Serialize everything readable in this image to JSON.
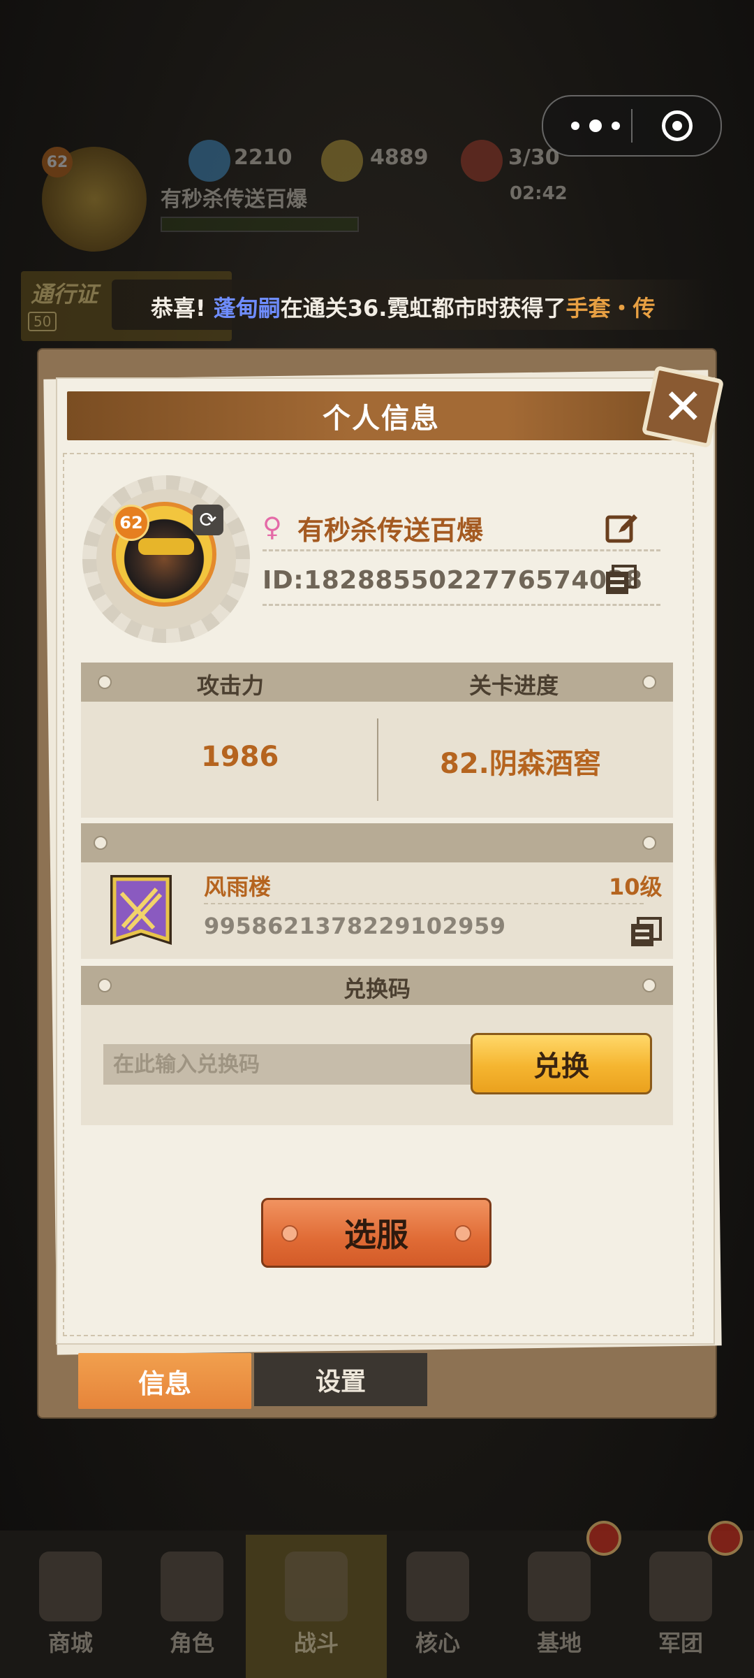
{
  "hud": {
    "player_level": "62",
    "gems": "2210",
    "coins": "4889",
    "stamina": "3/30",
    "timer": "02:42",
    "player_name": "有秒杀传送百爆"
  },
  "pass": {
    "label": "通行证",
    "level": "50"
  },
  "ticker": {
    "prefix": "恭喜!",
    "player": "蓬甸嗣",
    "middle": "在通关36.霓虹都市时获得了",
    "item": "手套・传"
  },
  "dialog": {
    "title": "个人信息",
    "profile": {
      "level": "62",
      "name": "有秒杀传送百爆",
      "id": "ID:1828855022776574038"
    },
    "stats": {
      "attack_label": "攻击力",
      "progress_label": "关卡进度",
      "attack_value": "1986",
      "progress_value": "82.阴森酒窖"
    },
    "guild": {
      "name": "风雨楼",
      "level": "10级",
      "id": "995862137822910295​9"
    },
    "redeem": {
      "title": "兑换码",
      "placeholder": "在此输入兑换码",
      "button": "兑换"
    },
    "server_button": "选服",
    "tabs": {
      "info": "信息",
      "settings": "设置"
    }
  },
  "bottom_nav": [
    "商城",
    "角色",
    "战斗",
    "核心",
    "基地",
    "军团"
  ],
  "colors": {
    "accent_orange": "#e6843a",
    "name_brown": "#a45a21",
    "gold": "#f5b530"
  }
}
